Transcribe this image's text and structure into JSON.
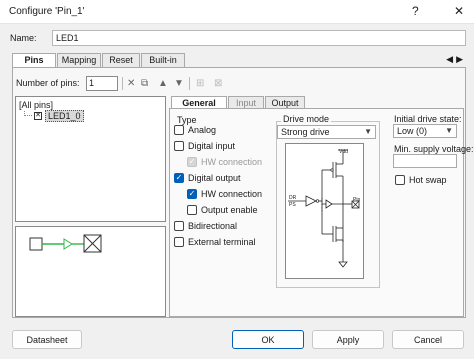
{
  "window": {
    "title": "Configure 'Pin_1'",
    "help_icon": "?",
    "close_icon": "✕"
  },
  "name": {
    "label": "Name:",
    "value": "LED1"
  },
  "tabs": [
    {
      "label": "Pins"
    },
    {
      "label": "Mapping"
    },
    {
      "label": "Reset"
    },
    {
      "label": "Built-in"
    }
  ],
  "tab_nav": {
    "left": "◀",
    "right": "▶"
  },
  "pins": {
    "count_label": "Number of pins:",
    "count_value": "1",
    "toolbar_icons": [
      "delete-icon",
      "assign-icon",
      "move-up-icon",
      "move-down-icon",
      "group-icon",
      "ungroup-icon"
    ]
  },
  "tree": {
    "root": "[All pins]",
    "items": [
      {
        "label": "LED1_0"
      }
    ]
  },
  "inner_tabs": [
    {
      "label": "General"
    },
    {
      "label": "Input"
    },
    {
      "label": "Output"
    }
  ],
  "type_group": {
    "title": "Type",
    "options": [
      {
        "label": "Analog",
        "checked": false,
        "enabled": true
      },
      {
        "label": "Digital input",
        "checked": false,
        "enabled": true
      },
      {
        "label": "HW connection",
        "checked": true,
        "enabled": false
      },
      {
        "label": "Digital output",
        "checked": true,
        "enabled": true
      },
      {
        "label": "HW connection",
        "checked": true,
        "enabled": true
      },
      {
        "label": "Output enable",
        "checked": false,
        "enabled": true
      },
      {
        "label": "Bidirectional",
        "checked": false,
        "enabled": true
      },
      {
        "label": "External terminal",
        "checked": false,
        "enabled": true
      }
    ]
  },
  "drive_mode": {
    "title": "Drive mode",
    "selected": "Strong drive",
    "diagram": {
      "vdd": "Vdd",
      "dr": "DR",
      "ps": "PS",
      "pin": "Pin"
    }
  },
  "right_group": {
    "initial_state_label": "Initial drive state:",
    "initial_state_value": "Low (0)",
    "min_supply_label": "Min. supply voltage:",
    "min_supply_value": "",
    "hot_swap_label": "Hot swap",
    "hot_swap_checked": false
  },
  "buttons": {
    "datasheet": "Datasheet",
    "ok": "OK",
    "apply": "Apply",
    "cancel": "Cancel"
  },
  "colors": {
    "accent": "#005fb8",
    "preview_wire": "#2fb94a"
  }
}
